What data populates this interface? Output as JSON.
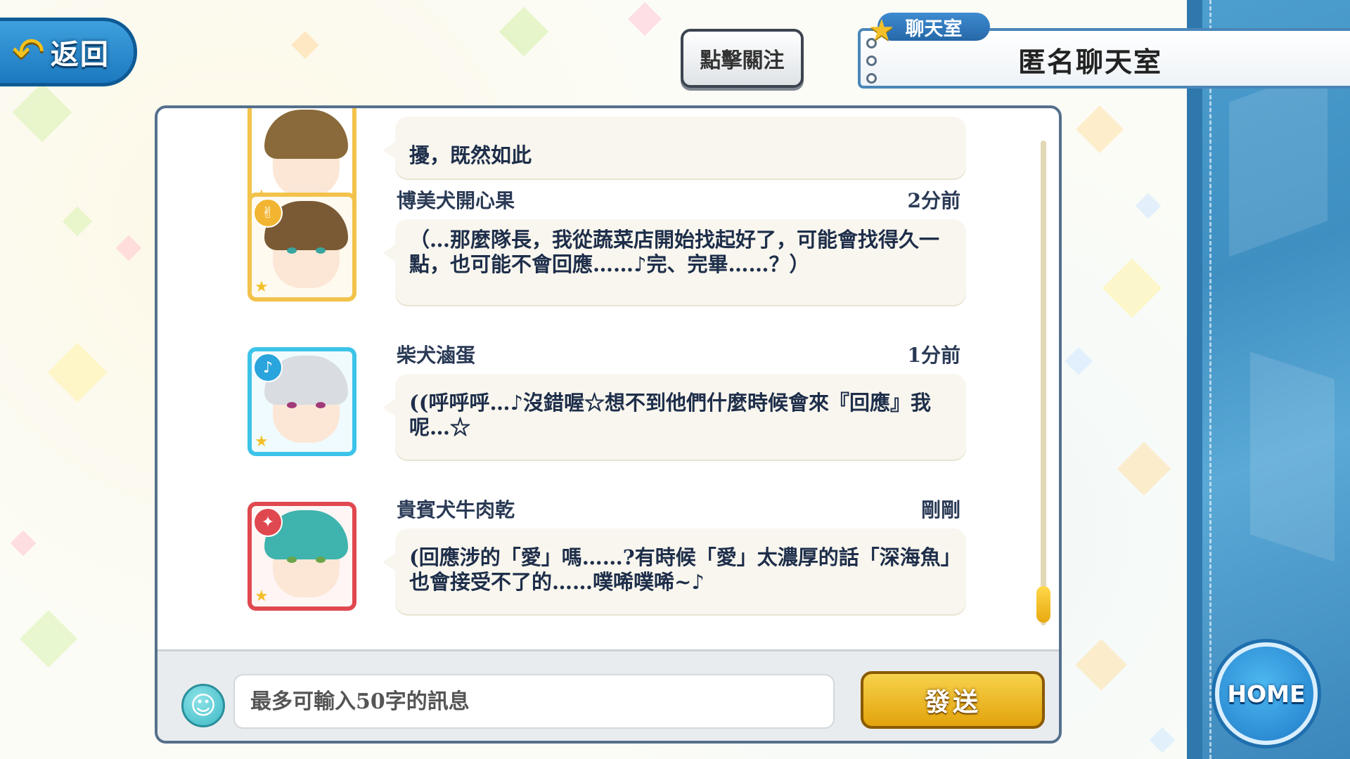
{
  "nav": {
    "back_label": "返回",
    "follow_label": "點擊關注",
    "home_label": "HOME"
  },
  "room": {
    "tab_label": "聊天室",
    "title": "匿名聊天室"
  },
  "messages": [
    {
      "name": "",
      "time": "",
      "text": "擾，既然如此",
      "frame_color": "#f2c24a",
      "hair_color": "#8a6a3a"
    },
    {
      "name": "博美犬開心果",
      "time": "2分前",
      "text": "（…那麼隊長，我從蔬菜店開始找起好了，可能會找得久一點，也可能不會回應……♪完、完畢……？）",
      "frame_color": "#f2c24a",
      "hair_color": "#7a5a34",
      "eye_color": "#3aa5a0"
    },
    {
      "name": "柴犬滷蛋",
      "time": "1分前",
      "text": "((呼呼呼…♪沒錯喔☆想不到他們什麼時候會來『回應』我呢…☆",
      "frame_color": "#3cc3e8",
      "hair_color": "#d9dde2",
      "eye_color": "#a23a7a"
    },
    {
      "name": "貴賓犬牛肉乾",
      "time": "剛剛",
      "text": "(回應涉的「愛」嗎……?有時候「愛」太濃厚的話「深海魚」也會接受不了的……噗唏噗唏~♪",
      "frame_color": "#e0484f",
      "hair_color": "#3fb3ad",
      "eye_color": "#6aa54a"
    }
  ],
  "composer": {
    "placeholder": "最多可輸入50字的訊息",
    "send_label": "發送"
  },
  "colors": {
    "accent_blue": "#1c79bf",
    "send_gold": "#e2a30c",
    "side_panel": "#4d9fcf"
  },
  "icons": {
    "back": "undo-arrow-icon",
    "room": "star-icon",
    "emoji": "smiley-icon"
  }
}
